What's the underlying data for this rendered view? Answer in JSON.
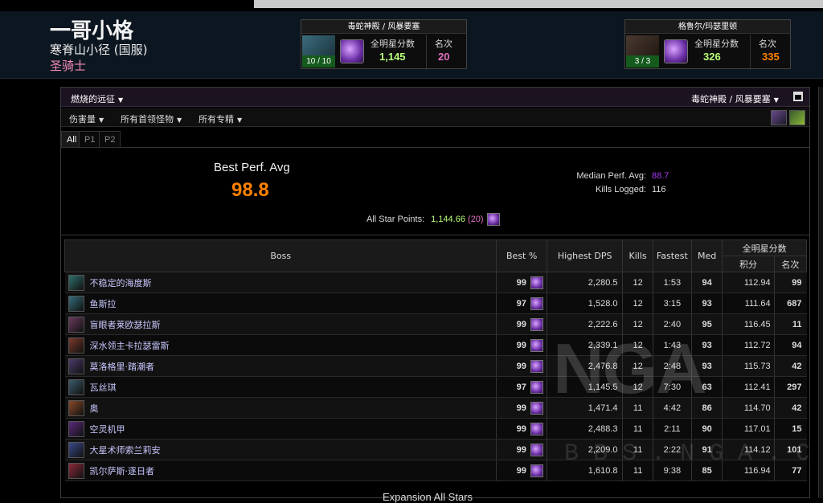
{
  "character": {
    "name": "一哥小格",
    "realm": "寒脊山小径 (国服)",
    "class": "圣骑士"
  },
  "zones": [
    {
      "title": "毒蛇神殿 / 风暴要塞",
      "progress": "10 / 10",
      "score_label": "全明星分数",
      "score": "1,145",
      "rank_label": "名次",
      "rank": "20"
    },
    {
      "title": "格鲁尔/玛瑟里顿",
      "progress": "3 / 3",
      "score_label": "全明星分数",
      "score": "326",
      "rank_label": "名次",
      "rank": "335"
    }
  ],
  "panel": {
    "expansion": "燃烧的远征",
    "zone": "毒蛇神殿 / 风暴要塞",
    "metric": "伤害量",
    "bosses_filter": "所有首领怪物",
    "spec_filter": "所有专精",
    "tabs": [
      "All",
      "P1",
      "P2"
    ]
  },
  "summary": {
    "best_perf_label": "Best Perf. Avg",
    "best_perf_value": "98.8",
    "median_label": "Median Perf. Avg:",
    "median_value": "88.7",
    "kills_label": "Kills Logged:",
    "kills_value": "116",
    "asp_label": "All Star Points:",
    "asp_value": "1,144.66",
    "asp_rank": "(20)"
  },
  "table": {
    "headers": {
      "boss": "Boss",
      "best": "Best %",
      "dps": "Highest DPS",
      "kills": "Kills",
      "fastest": "Fastest",
      "med": "Med",
      "allstar": "全明星分数",
      "points": "积分",
      "rank": "名次"
    },
    "rows": [
      {
        "boss": "不稳定的海度斯",
        "best": "99",
        "dps": "2,280.5",
        "kills": "12",
        "fastest": "1:53",
        "med": "94",
        "points": "112.94",
        "rank": "99",
        "best_q": "q-pink",
        "med_q": "q-pur",
        "rank_q": "q-pink",
        "icon": "#2f6f6a"
      },
      {
        "boss": "鱼斯拉",
        "best": "97",
        "dps": "1,528.0",
        "kills": "12",
        "fastest": "3:15",
        "med": "93",
        "points": "111.64",
        "rank": "687",
        "best_q": "q-ora",
        "med_q": "q-pur",
        "rank_q": "q-ora",
        "icon": "#356d7a"
      },
      {
        "boss": "盲眼者莱欧瑟拉斯",
        "best": "99",
        "dps": "2,222.6",
        "kills": "12",
        "fastest": "2:40",
        "med": "95",
        "points": "116.45",
        "rank": "11",
        "best_q": "q-pink",
        "med_q": "q-ora",
        "rank_q": "q-pink",
        "icon": "#6a3a5a"
      },
      {
        "boss": "深水领主卡拉瑟雷斯",
        "best": "99",
        "dps": "2,339.1",
        "kills": "12",
        "fastest": "1:43",
        "med": "93",
        "points": "112.72",
        "rank": "94",
        "best_q": "q-pink",
        "med_q": "q-pur",
        "rank_q": "q-pink",
        "icon": "#7a3a2a"
      },
      {
        "boss": "莫洛格里·踏潮者",
        "best": "99",
        "dps": "2,476.8",
        "kills": "12",
        "fastest": "2:48",
        "med": "93",
        "points": "115.73",
        "rank": "42",
        "best_q": "q-pink",
        "med_q": "q-pur",
        "rank_q": "q-pink",
        "icon": "#4a3a6a"
      },
      {
        "boss": "瓦丝琪",
        "best": "97",
        "dps": "1,145.5",
        "kills": "12",
        "fastest": "7:30",
        "med": "63",
        "points": "112.41",
        "rank": "297",
        "best_q": "q-ora",
        "med_q": "q-blu",
        "rank_q": "q-ora",
        "icon": "#3a5a6a"
      },
      {
        "boss": "奥",
        "best": "99",
        "dps": "1,471.4",
        "kills": "11",
        "fastest": "4:42",
        "med": "86",
        "points": "114.70",
        "rank": "42",
        "best_q": "q-pink",
        "med_q": "q-pur",
        "rank_q": "q-pink",
        "icon": "#8a4a2a"
      },
      {
        "boss": "空灵机甲",
        "best": "99",
        "dps": "2,488.3",
        "kills": "11",
        "fastest": "2:11",
        "med": "90",
        "points": "117.01",
        "rank": "15",
        "best_q": "q-pink",
        "med_q": "q-pur",
        "rank_q": "q-pink",
        "icon": "#5a2a7a"
      },
      {
        "boss": "大星术师索兰莉安",
        "best": "99",
        "dps": "2,209.0",
        "kills": "11",
        "fastest": "2:22",
        "med": "91",
        "points": "114.12",
        "rank": "101",
        "best_q": "q-pink",
        "med_q": "q-pur",
        "rank_q": "q-pink",
        "icon": "#3a4a8a"
      },
      {
        "boss": "凯尔萨斯·逐日者",
        "best": "99",
        "dps": "1,610.8",
        "kills": "11",
        "fastest": "9:38",
        "med": "85",
        "points": "116.94",
        "rank": "77",
        "best_q": "q-pink",
        "med_q": "q-pur",
        "rank_q": "q-pink",
        "icon": "#8a2a3a"
      }
    ]
  },
  "footer": {
    "expansion_all_stars": "Expansion All Stars"
  },
  "watermark": {
    "logo": "NGA",
    "sub": "BBS.NGA.CN"
  }
}
